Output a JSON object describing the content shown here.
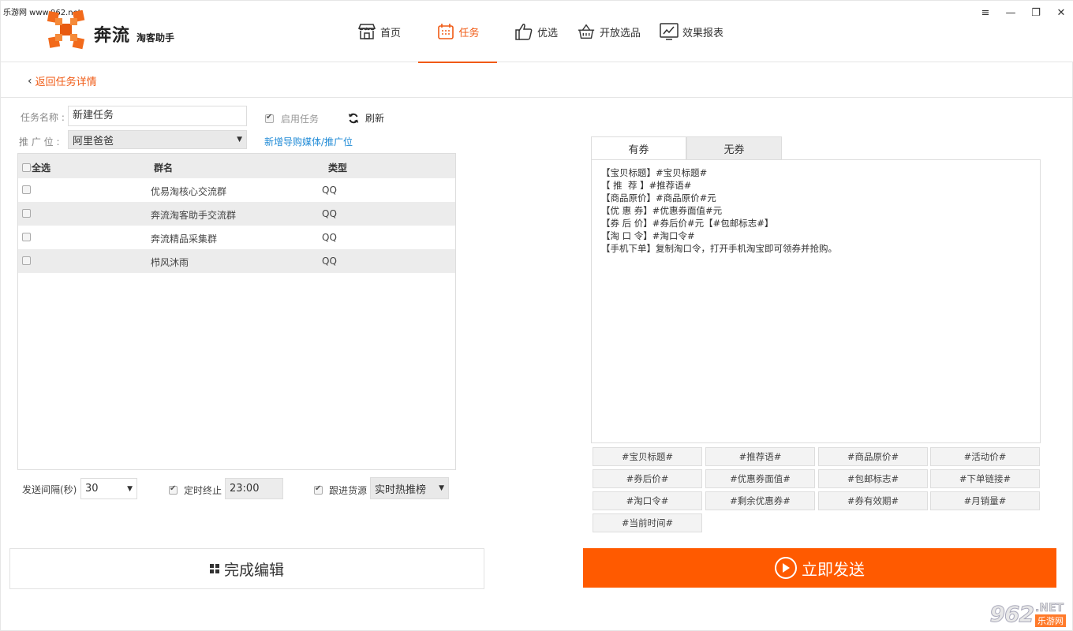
{
  "watermark_top": "乐游网 www.962.net",
  "app": {
    "name": "奔流",
    "subtitle": "淘客助手",
    "accent": "#f05a14",
    "send_color": "#ff5a00"
  },
  "nav": [
    {
      "label": "首页",
      "icon": "store-icon"
    },
    {
      "label": "任务",
      "icon": "calendar-icon",
      "active": true
    },
    {
      "label": "优选",
      "icon": "thumbs-up-icon"
    },
    {
      "label": "开放选品",
      "icon": "basket-icon"
    },
    {
      "label": "效果报表",
      "icon": "chart-icon"
    }
  ],
  "window_controls": {
    "menu": "≡",
    "minimize": "—",
    "restore": "❐",
    "close": "✕"
  },
  "back_label": "返回任务详情",
  "form": {
    "task_name_label": "任务名称 :",
    "task_name_value": "新建任务",
    "enable_label": "启用任务",
    "refresh_label": "刷新",
    "position_label": "推 广 位 :",
    "position_value": "阿里爸爸",
    "add_media_link": "新增导购媒体/推广位"
  },
  "table": {
    "headers": {
      "select_all": "全选",
      "name": "群名",
      "type": "类型"
    },
    "rows": [
      {
        "name": "优易淘核心交流群",
        "type": "QQ"
      },
      {
        "name": "奔流淘客助手交流群",
        "type": "QQ"
      },
      {
        "name": "奔流精品采集群",
        "type": "QQ"
      },
      {
        "name": "栉风沐雨",
        "type": "QQ"
      }
    ]
  },
  "bottom": {
    "interval_label": "发送间隔(秒)",
    "interval_value": "30",
    "stop_label": "定时终止",
    "stop_value": "23:00",
    "follow_label": "跟进货源",
    "follow_value": "实时热推榜",
    "finish_label": "完成编辑",
    "send_label": "立即发送"
  },
  "tabs": [
    "有券",
    "无券"
  ],
  "editor_lines": [
    "【宝贝标题】#宝贝标题#",
    "【 推  荐 】#推荐语#",
    "【商品原价】#商品原价#元",
    "【优 惠 券】#优惠券面值#元",
    "【券 后 价】#券后价#元【#包邮标志#】",
    "【淘 口 令】#淘口令#",
    "【手机下单】复制淘口令，打开手机淘宝即可领券并抢购。"
  ],
  "tags": [
    "#宝贝标题#",
    "#推荐语#",
    "#商品原价#",
    "#活动价#",
    "#券后价#",
    "#优惠券面值#",
    "#包邮标志#",
    "#下单链接#",
    "#淘口令#",
    "#剩余优惠券#",
    "#券有效期#",
    "#月销量#",
    "#当前时间#"
  ],
  "watermark_br": {
    "number": "962",
    "net": ".NET",
    "cn": "乐游网"
  }
}
